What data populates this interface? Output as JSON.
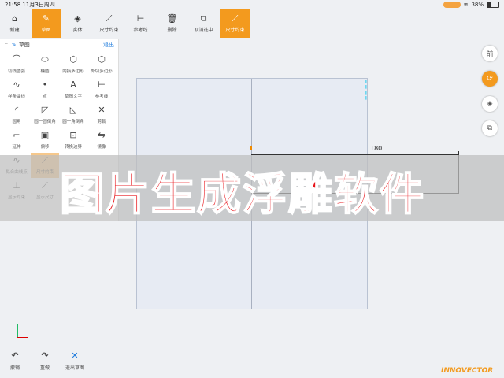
{
  "status": {
    "time": "21:58",
    "date": "11月3日周四",
    "battery": "38%"
  },
  "toolbar": [
    {
      "label": "新建",
      "icon": "⌂",
      "active": false
    },
    {
      "label": "草图",
      "icon": "✎",
      "active": true
    },
    {
      "label": "实体",
      "icon": "◈",
      "active": false
    },
    {
      "label": "尺寸约束",
      "icon": "⟋",
      "active": false
    },
    {
      "label": "参考线",
      "icon": "⊢",
      "active": false
    },
    {
      "label": "删除",
      "icon": "🗑",
      "active": false
    },
    {
      "label": "取消选中",
      "icon": "⧉",
      "active": false
    },
    {
      "label": "尺寸约束",
      "icon": "⟋",
      "active": true
    }
  ],
  "panel": {
    "title": "草图",
    "exit": "退出",
    "tools": [
      {
        "label": "切线圆弧",
        "icon": "⌒"
      },
      {
        "label": "椭圆",
        "icon": "⬭"
      },
      {
        "label": "内接多边形",
        "icon": "⬡"
      },
      {
        "label": "外切多边形",
        "icon": "⬡"
      },
      {
        "label": "样条曲线",
        "icon": "∿"
      },
      {
        "label": "点",
        "icon": "•"
      },
      {
        "label": "草图文字",
        "icon": "A"
      },
      {
        "label": "参考线",
        "icon": "⊢"
      },
      {
        "label": "圆角",
        "icon": "◜"
      },
      {
        "label": "圆一圆倒角",
        "icon": "◸"
      },
      {
        "label": "圆一角倒角",
        "icon": "◺"
      },
      {
        "label": "剪裁",
        "icon": "✕"
      },
      {
        "label": "延伸",
        "icon": "⌐"
      },
      {
        "label": "偏移",
        "icon": "▣"
      },
      {
        "label": "转换边界",
        "icon": "⊡"
      },
      {
        "label": "镜像",
        "icon": "⇋"
      },
      {
        "label": "拟合曲线点",
        "icon": "∿"
      },
      {
        "label": "尺寸约束",
        "icon": "⟋",
        "selected": true
      },
      {
        "label": "",
        "icon": ""
      },
      {
        "label": "",
        "icon": ""
      },
      {
        "label": "显示约束",
        "icon": "⊥"
      },
      {
        "label": "显示尺寸",
        "icon": "⟋"
      }
    ]
  },
  "canvas": {
    "dimension": "180"
  },
  "banner": {
    "text": "图片生成浮雕软件"
  },
  "side": [
    {
      "label": "前",
      "icon": "前"
    },
    {
      "label": "",
      "icon": "⟳"
    },
    {
      "label": "",
      "icon": "◈"
    },
    {
      "label": "",
      "icon": "⧉"
    }
  ],
  "bottom": [
    {
      "label": "撤销",
      "icon": "↶"
    },
    {
      "label": "重做",
      "icon": "↷"
    },
    {
      "label": "退出草图",
      "icon": "✕"
    }
  ],
  "brand": "INNOVECTOR",
  "colors": {
    "accent": "#f39a1e",
    "banner_text": "#e8141a",
    "link": "#1e7bdc"
  }
}
